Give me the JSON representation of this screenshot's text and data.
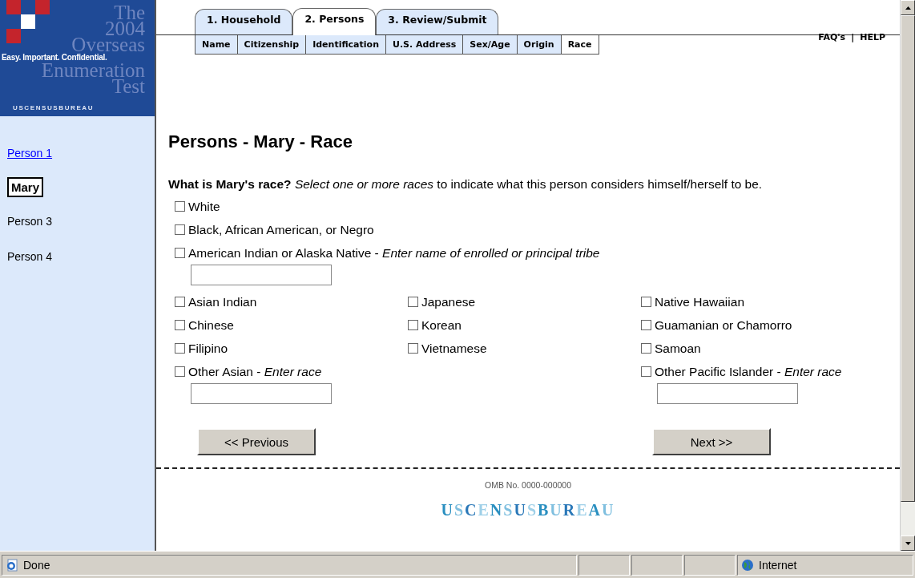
{
  "logo": {
    "lines": [
      "The",
      "2004",
      "Overseas",
      "Enumeration",
      "Test"
    ],
    "tagline": "Easy. Important. Confidential.",
    "agency": "USCENSUSBUREAU"
  },
  "tabs": [
    {
      "label": "1. Household",
      "selected": false
    },
    {
      "label": "2. Persons",
      "selected": true
    },
    {
      "label": "3. Review/Submit",
      "selected": false
    }
  ],
  "links": [
    "FAQ's",
    "HELP"
  ],
  "link_separator": "|",
  "subtabs": [
    {
      "label": "Name",
      "selected": false
    },
    {
      "label": "Citizenship",
      "selected": false
    },
    {
      "label": "Identification",
      "selected": false
    },
    {
      "label": "U.S. Address",
      "selected": false
    },
    {
      "label": "Sex/Age",
      "selected": false
    },
    {
      "label": "Origin",
      "selected": false
    },
    {
      "label": "Race",
      "selected": true
    }
  ],
  "persons": [
    {
      "label": "Person 1",
      "kind": "link"
    },
    {
      "label": "Mary",
      "kind": "current"
    },
    {
      "label": "Person 3",
      "kind": "plain"
    },
    {
      "label": "Person 4",
      "kind": "plain"
    }
  ],
  "heading": "Persons - Mary - Race",
  "question": "**What is Mary's race?** *Select one or more races* to indicate what this person considers himself/herself to be.",
  "options": [
    {
      "label": "White",
      "checked": false,
      "kind": "checkbox"
    },
    {
      "label": "Black, African American, or Negro",
      "checked": false,
      "kind": "checkbox"
    },
    {
      "label": "American Indian or Alaska Native - *Enter name of enrolled or principal tribe*",
      "checked": false,
      "kind": "checkbox_with_field"
    }
  ],
  "columns": [
    [
      {
        "label": "Asian Indian",
        "checked": false,
        "kind": "checkbox"
      },
      {
        "label": "Chinese",
        "checked": false,
        "kind": "checkbox"
      },
      {
        "label": "Filipino",
        "checked": false,
        "kind": "checkbox"
      },
      {
        "label": "Other Asian - *Enter race*",
        "checked": false,
        "kind": "checkbox_with_field"
      }
    ],
    [
      {
        "label": "Japanese",
        "checked": false,
        "kind": "checkbox"
      },
      {
        "label": "Korean",
        "checked": false,
        "kind": "checkbox"
      },
      {
        "label": "Vietnamese",
        "checked": false,
        "kind": "checkbox"
      }
    ],
    [
      {
        "label": "Native Hawaiian",
        "checked": false,
        "kind": "checkbox"
      },
      {
        "label": "Guamanian or Chamorro",
        "checked": false,
        "kind": "checkbox"
      },
      {
        "label": "Samoan",
        "checked": false,
        "kind": "checkbox"
      },
      {
        "label": "Other Pacific Islander - *Enter race*",
        "checked": false,
        "kind": "checkbox_with_field"
      }
    ]
  ],
  "buttons": [
    "<< Previous",
    "Next >>"
  ],
  "footer": {
    "omb": "OMB No. 0000-000000",
    "agency": "USCENSUSBUREAU"
  },
  "status_bar": {
    "status": "Done",
    "zone": "Internet"
  }
}
